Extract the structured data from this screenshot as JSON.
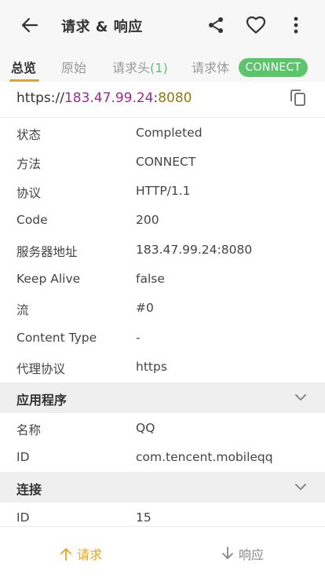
{
  "appbar": {
    "title": "请求 & 响应",
    "icons": {
      "back": "arrow-left-icon",
      "share": "share-icon",
      "favorite": "heart-icon",
      "more": "more-vertical-icon"
    }
  },
  "tabs": {
    "overview": "总览",
    "raw": "原始",
    "request_headers": "请求头",
    "request_headers_count": "(1)",
    "request_body": "请求体",
    "method_badge": "CONNECT"
  },
  "url": {
    "scheme": "https://",
    "host": "183.47.99.24",
    "colon": ":",
    "port": "8080"
  },
  "details": [
    {
      "key": "状态",
      "value": "Completed"
    },
    {
      "key": "方法",
      "value": "CONNECT"
    },
    {
      "key": "协议",
      "value": "HTTP/1.1"
    },
    {
      "key": "Code",
      "value": "200"
    },
    {
      "key": "服务器地址",
      "value": "183.47.99.24:8080"
    },
    {
      "key": "Keep Alive",
      "value": "false"
    },
    {
      "key": "流",
      "value": "#0"
    },
    {
      "key": "Content Type",
      "value": "-"
    },
    {
      "key": "代理协议",
      "value": "https"
    }
  ],
  "app_section": {
    "title": "应用程序",
    "rows": [
      {
        "key": "名称",
        "value": "QQ"
      },
      {
        "key": "ID",
        "value": "com.tencent.mobileqq"
      }
    ]
  },
  "connection_section": {
    "title": "连接",
    "rows": [
      {
        "key": "ID",
        "value": "15"
      }
    ]
  },
  "bottom": {
    "request": "请求",
    "response": "响应"
  },
  "colors": {
    "accent": "#e9a21f",
    "badge": "#5cc46a",
    "host": "#9c2b8b",
    "port": "#8f7a10"
  }
}
